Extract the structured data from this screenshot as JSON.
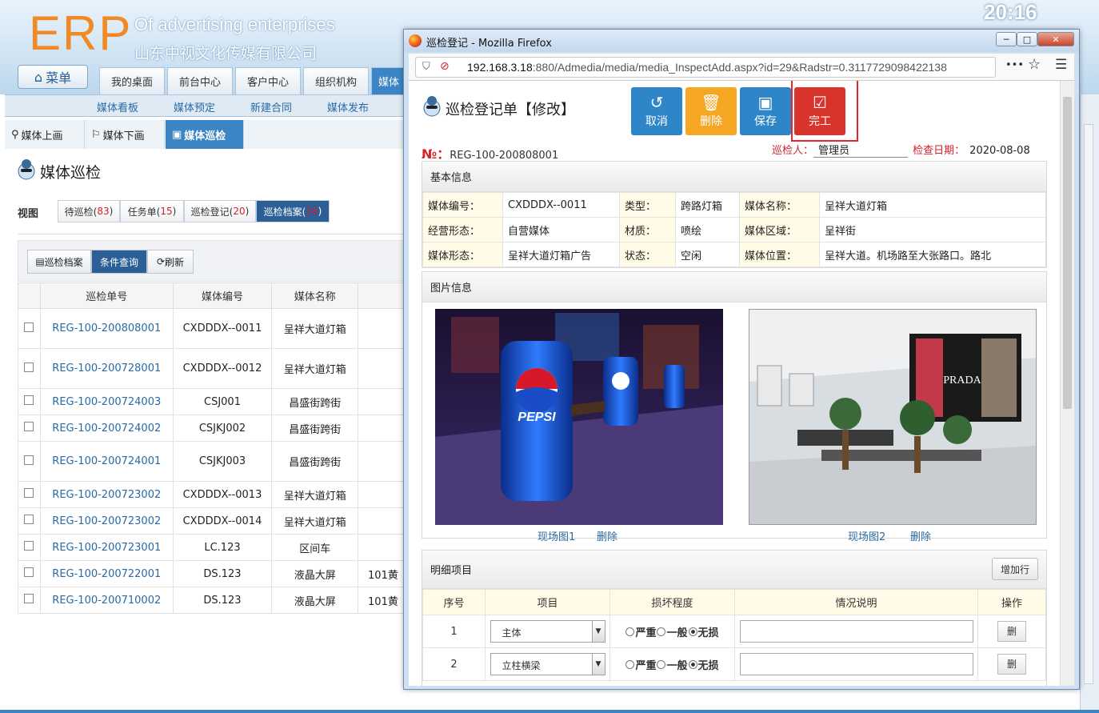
{
  "erp": {
    "logo": "ERP",
    "subtitle_en": "Of advertising enterprises",
    "company": "山东中视文化传媒有限公司",
    "clock": "20:16",
    "menu_label": "菜单",
    "top_tabs": [
      "我的桌面",
      "前台中心",
      "客户中心",
      "组织机构",
      "媒体"
    ],
    "subnav": [
      "媒体看板",
      "媒体预定",
      "新建合同",
      "媒体发布"
    ],
    "page_tabs": [
      "媒体上画",
      "媒体下画",
      "媒体巡检"
    ],
    "page_title": "媒体巡检",
    "view_label": "视图",
    "view_tabs": [
      {
        "label": "待巡检(",
        "count": "83",
        "end": ")"
      },
      {
        "label": "任务单(",
        "count": "15",
        "end": ")"
      },
      {
        "label": "巡检登记(",
        "count": "20",
        "end": ")"
      },
      {
        "label": "巡检档案(",
        "count": "28",
        "end": ")"
      }
    ],
    "toolbar": [
      "巡检档案",
      "条件查询",
      "刷新"
    ],
    "grid_headers": [
      "巡检单号",
      "媒体编号",
      "媒体名称"
    ],
    "rows": [
      {
        "no": "REG-100-200808001",
        "code": "CXDDDX--0011",
        "name": "呈祥大道灯箱",
        "extra": ""
      },
      {
        "no": "REG-100-200728001",
        "code": "CXDDDX--0012",
        "name": "呈祥大道灯箱",
        "extra": ""
      },
      {
        "no": "REG-100-200724003",
        "code": "CSJ001",
        "name": "昌盛街跨街",
        "extra": ""
      },
      {
        "no": "REG-100-200724002",
        "code": "CSJKJ002",
        "name": "昌盛街跨街",
        "extra": ""
      },
      {
        "no": "REG-100-200724001",
        "code": "CSJKJ003",
        "name": "昌盛街跨街",
        "extra": ""
      },
      {
        "no": "REG-100-200723002",
        "code": "CXDDDX--0013",
        "name": "呈祥大道灯箱",
        "extra": ""
      },
      {
        "no": "REG-100-200723002",
        "code": "CXDDDX--0014",
        "name": "呈祥大道灯箱",
        "extra": ""
      },
      {
        "no": "REG-100-200723001",
        "code": "LC.123",
        "name": "区间车",
        "extra": ""
      },
      {
        "no": "REG-100-200722001",
        "code": "DS.123",
        "name": "液晶大屏",
        "extra": "101黄"
      },
      {
        "no": "REG-100-200710002",
        "code": "DS.123",
        "name": "液晶大屏",
        "extra": "101黄"
      }
    ]
  },
  "firefox": {
    "title": "巡检登记 - Mozilla Firefox",
    "url_host": "192.168.3.18",
    "url_rest": ":880/Admedia/media/media_InspectAdd.aspx?id=29&Radstr=0.3117729098422138",
    "win_minimize": "─",
    "win_maximize": "□",
    "win_close": "✕",
    "more": "•••",
    "star": "☆",
    "hamburger": "☰"
  },
  "form": {
    "title": "巡检登记单【修改】",
    "buttons": {
      "cancel": "取消",
      "delete": "删除",
      "save": "保存",
      "complete": "完工"
    },
    "no_label": "№：",
    "no_value": "REG-100-200808001",
    "inspector_label": "巡检人：",
    "inspector_value": "管理员",
    "date_label": "检查日期：",
    "date_value": "2020-08-08",
    "basic_title": "基本信息",
    "basic": [
      [
        "媒体编号：",
        "CXDDDX--0011",
        "类型：",
        "跨路灯箱",
        "媒体名称：",
        "呈祥大道灯箱"
      ],
      [
        "经营形态：",
        "自营媒体",
        "材质：",
        "喷绘",
        "媒体区域：",
        "呈祥街"
      ],
      [
        "媒体形态：",
        "呈祥大道灯箱广告",
        "状态：",
        "空闲",
        "媒体位置：",
        "呈祥大道。机场路至大张路口。路北"
      ]
    ],
    "photo_title": "图片信息",
    "photo1_caption": "现场图1",
    "photo2_caption": "现场图2",
    "photo_delete": "删除",
    "pepsi_text": "PEPSI",
    "prada_text": "PRADA",
    "detail_title": "明细项目",
    "add_row": "增加行",
    "detail_headers": [
      "序号",
      "项目",
      "损坏程度",
      "情况说明",
      "操作"
    ],
    "severity": [
      "严重",
      "一般",
      "无损"
    ],
    "detail_rows": [
      {
        "seq": "1",
        "item": "主体"
      },
      {
        "seq": "2",
        "item": "立柱横梁"
      }
    ],
    "row_delete": "删"
  }
}
